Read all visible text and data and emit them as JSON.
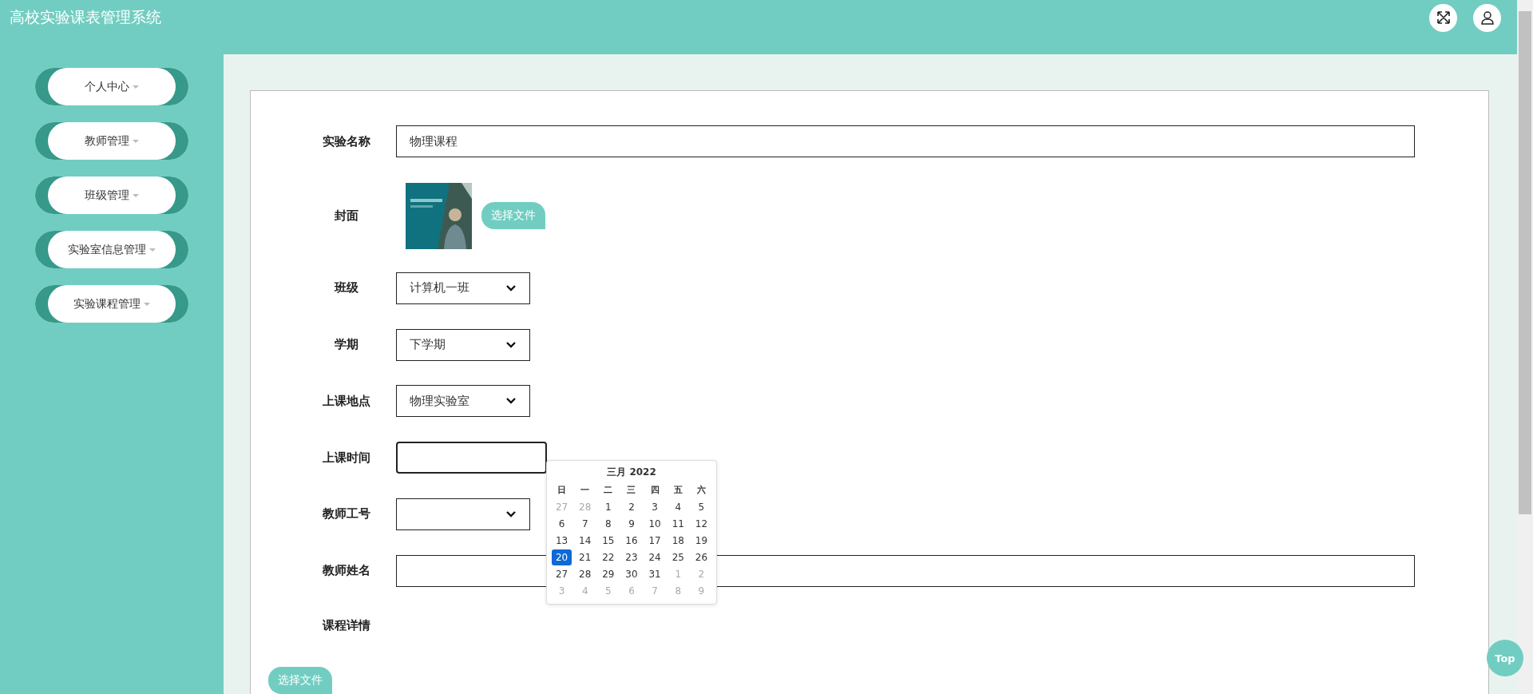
{
  "header": {
    "title": "高校实验课表管理系统"
  },
  "sidebar": {
    "items": [
      {
        "label": "个人中心"
      },
      {
        "label": "教师管理"
      },
      {
        "label": "班级管理"
      },
      {
        "label": "实验室信息管理"
      },
      {
        "label": "实验课程管理"
      }
    ]
  },
  "form": {
    "fields": [
      {
        "kind": "text",
        "label": "实验名称",
        "value": "物理课程"
      },
      {
        "label": "封面",
        "button": "选择文件"
      },
      {
        "kind": "select",
        "label": "班级",
        "value": "计算机一班"
      },
      {
        "kind": "select",
        "label": "学期",
        "value": "下学期"
      },
      {
        "kind": "select",
        "label": "上课地点",
        "value": "物理实验室"
      },
      {
        "kind": "date",
        "label": "上课时间",
        "focused": true
      },
      {
        "kind": "select",
        "label": "教师工号"
      },
      {
        "kind": "wide",
        "label": "教师姓名"
      },
      {
        "kind": "editor",
        "label": "课程详情",
        "button": "选择文件"
      }
    ]
  },
  "calendar": {
    "title": "三月 2022",
    "weekdays": [
      "日",
      "一",
      "二",
      "三",
      "四",
      "五",
      "六"
    ],
    "weeks": [
      [
        {
          "day": "27",
          "muted": true,
          "selected": false
        },
        {
          "day": "28",
          "muted": true,
          "selected": false
        },
        {
          "day": "1",
          "muted": false,
          "selected": false
        },
        {
          "day": "2",
          "muted": false,
          "selected": false
        },
        {
          "day": "3",
          "muted": false,
          "selected": false
        },
        {
          "day": "4",
          "muted": false,
          "selected": false
        },
        {
          "day": "5",
          "muted": false,
          "selected": false
        }
      ],
      [
        {
          "day": "6",
          "muted": false,
          "selected": false
        },
        {
          "day": "7",
          "muted": false,
          "selected": false
        },
        {
          "day": "8",
          "muted": false,
          "selected": false
        },
        {
          "day": "9",
          "muted": false,
          "selected": false
        },
        {
          "day": "10",
          "muted": false,
          "selected": false
        },
        {
          "day": "11",
          "muted": false,
          "selected": false
        },
        {
          "day": "12",
          "muted": false,
          "selected": false
        }
      ],
      [
        {
          "day": "13",
          "muted": false,
          "selected": false
        },
        {
          "day": "14",
          "muted": false,
          "selected": false
        },
        {
          "day": "15",
          "muted": false,
          "selected": false
        },
        {
          "day": "16",
          "muted": false,
          "selected": false
        },
        {
          "day": "17",
          "muted": false,
          "selected": false
        },
        {
          "day": "18",
          "muted": false,
          "selected": false
        },
        {
          "day": "19",
          "muted": false,
          "selected": false
        }
      ],
      [
        {
          "day": "20",
          "muted": false,
          "selected": true
        },
        {
          "day": "21",
          "muted": false,
          "selected": false
        },
        {
          "day": "22",
          "muted": false,
          "selected": false
        },
        {
          "day": "23",
          "muted": false,
          "selected": false
        },
        {
          "day": "24",
          "muted": false,
          "selected": false
        },
        {
          "day": "25",
          "muted": false,
          "selected": false
        },
        {
          "day": "26",
          "muted": false,
          "selected": false
        }
      ],
      [
        {
          "day": "27",
          "muted": false,
          "selected": false
        },
        {
          "day": "28",
          "muted": false,
          "selected": false
        },
        {
          "day": "29",
          "muted": false,
          "selected": false
        },
        {
          "day": "30",
          "muted": false,
          "selected": false
        },
        {
          "day": "31",
          "muted": false,
          "selected": false
        },
        {
          "day": "1",
          "muted": true,
          "selected": false
        },
        {
          "day": "2",
          "muted": true,
          "selected": false
        }
      ],
      [
        {
          "day": "3",
          "muted": true,
          "selected": false
        },
        {
          "day": "4",
          "muted": true,
          "selected": false
        },
        {
          "day": "5",
          "muted": true,
          "selected": false
        },
        {
          "day": "6",
          "muted": true,
          "selected": false
        },
        {
          "day": "7",
          "muted": true,
          "selected": false
        },
        {
          "day": "8",
          "muted": true,
          "selected": false
        },
        {
          "day": "9",
          "muted": true,
          "selected": false
        }
      ]
    ]
  },
  "top_button": "Top"
}
